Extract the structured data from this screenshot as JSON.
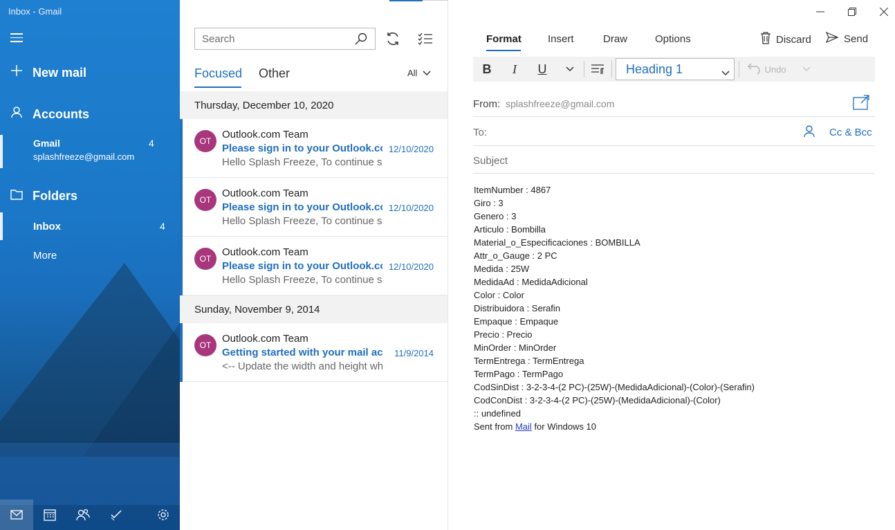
{
  "window": {
    "title": "Inbox - Gmail"
  },
  "nav": {
    "new_mail": "New mail",
    "accounts": "Accounts",
    "account": {
      "name": "Gmail",
      "count": "4",
      "email": "splashfreeze@gmail.com"
    },
    "folders": "Folders",
    "inbox": {
      "name": "Inbox",
      "count": "4"
    },
    "more": "More",
    "bottom_icons": [
      "mail-icon",
      "calendar-icon",
      "people-icon",
      "todo-icon",
      "settings-icon"
    ]
  },
  "list": {
    "search_placeholder": "Search",
    "tabs": {
      "focused": "Focused",
      "other": "Other"
    },
    "filter": "All",
    "groups": [
      {
        "date": "Thursday, December 10, 2020",
        "messages": [
          {
            "initials": "OT",
            "from": "Outlook.com Team",
            "subject": "Please sign in to your Outlook.com",
            "date": "12/10/2020",
            "preview": "Hello Splash Freeze, To continue se"
          },
          {
            "initials": "OT",
            "from": "Outlook.com Team",
            "subject": "Please sign in to your Outlook.com",
            "date": "12/10/2020",
            "preview": "Hello Splash Freeze, To continue se"
          },
          {
            "initials": "OT",
            "from": "Outlook.com Team",
            "subject": "Please sign in to your Outlook.com",
            "date": "12/10/2020",
            "preview": "Hello Splash Freeze, To continue se"
          }
        ]
      },
      {
        "date": "Sunday, November 9, 2014",
        "messages": [
          {
            "initials": "OT",
            "from": "Outlook.com Team",
            "subject": "Getting started with your mail acco",
            "date": "11/9/2014",
            "preview": "<-- Update the width and height wh"
          }
        ]
      }
    ]
  },
  "compose": {
    "tabs": {
      "format": "Format",
      "insert": "Insert",
      "draw": "Draw",
      "options": "Options"
    },
    "discard": "Discard",
    "send": "Send",
    "toolbar": {
      "bold": "B",
      "italic": "I",
      "underline": "U",
      "style": "Heading 1",
      "undo": "Undo"
    },
    "from_label": "From:",
    "from_value": "splashfreeze@gmail.com",
    "to_label": "To:",
    "cc_bcc": "Cc & Bcc",
    "subject_placeholder": "Subject",
    "body_lines": [
      "ItemNumber : 4867",
      "Giro : 3",
      "Genero : 3",
      "Articulo : Bombilla",
      "Material_o_Especificaciones : BOMBILLA",
      "Attr_o_Gauge : 2 PC",
      "Medida : 25W",
      "MedidaAd : MedidaAdicional",
      "Color : Color",
      "Distribuidora : Serafin",
      "Empaque : Empaque",
      "Precio : Precio",
      "MinOrder : MinOrder",
      "TermEntrega : TermEntrega",
      "TermPago : TermPago",
      "CodSinDist : 3-2-3-4-(2 PC)-(25W)-(MedidaAdicional)-(Color)-(Serafin)",
      "CodConDist : 3-2-3-4-(2 PC)-(25W)-(MedidaAdicional)-(Color)",
      ":: undefined"
    ],
    "signature": {
      "prefix": "Sent from ",
      "link": "Mail",
      "suffix": " for Windows 10"
    }
  },
  "colors": {
    "accent": "#1f6fbf",
    "nav_bg": "#1b78c8",
    "avatar": "#a8367b"
  }
}
